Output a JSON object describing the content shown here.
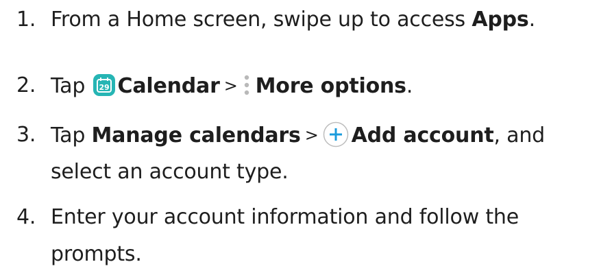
{
  "steps": [
    {
      "number": "1.",
      "parts": {
        "a": "From a Home screen, swipe up to access ",
        "b": "Apps",
        "c": "."
      }
    },
    {
      "number": "2.",
      "parts": {
        "a": "Tap ",
        "b": "Calendar",
        "sep": ">",
        "c": "More options",
        "d": "."
      }
    },
    {
      "number": "3.",
      "parts": {
        "a": "Tap ",
        "b": "Manage calendars",
        "sep": ">",
        "c": "Add account",
        "d": ", and",
        "e": "select an account type."
      }
    },
    {
      "number": "4.",
      "parts": {
        "a": "Enter your account information and follow the",
        "b": "prompts."
      }
    }
  ],
  "icons": {
    "calendar": "calendar-icon",
    "calendar_day": "29",
    "more_options": "more-options-icon",
    "add": "add-icon"
  },
  "colors": {
    "text": "#1e1e1e",
    "calendar_icon_bg": "#26b5b4",
    "add_icon": "#1a9bdc",
    "kebab": "#b9b9b9"
  }
}
